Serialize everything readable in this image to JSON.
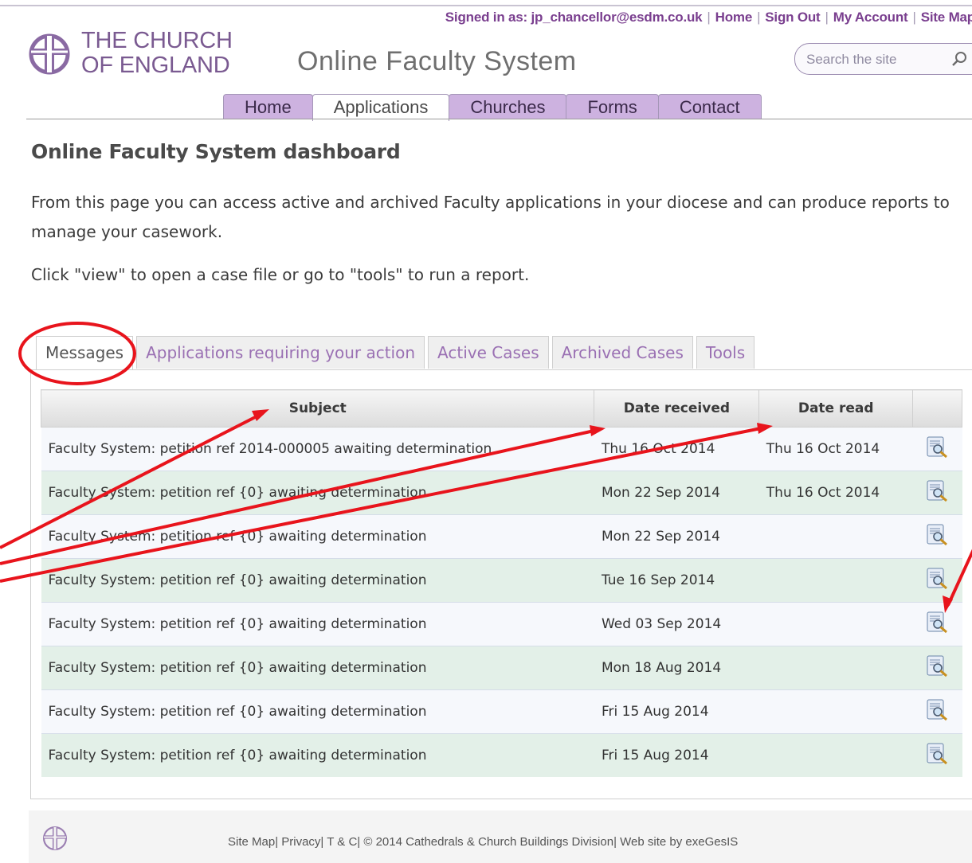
{
  "header": {
    "signed_in": "Signed in as: jp_chancellor@esdm.co.uk",
    "links": [
      "Home",
      "Sign Out",
      "My Account",
      "Site Map"
    ],
    "logo_line1": "THE CHURCH",
    "logo_line2": "OF ENGLAND",
    "system_title": "Online Faculty System",
    "search_placeholder": "Search the site"
  },
  "nav": {
    "tabs": [
      "Home",
      "Applications",
      "Churches",
      "Forms",
      "Contact"
    ],
    "active": "Applications"
  },
  "main": {
    "title": "Online Faculty System dashboard",
    "intro": "From this page you can access active and archived Faculty applications in your diocese and can produce reports to manage your casework.",
    "instruction": "Click \"view\" to open a case file or go to \"tools\" to run a report."
  },
  "subtabs": {
    "items": [
      "Messages",
      "Applications requiring your action",
      "Active Cases",
      "Archived Cases",
      "Tools"
    ],
    "active": "Messages"
  },
  "table": {
    "columns": [
      "Subject",
      "Date received",
      "Date read",
      ""
    ],
    "rows": [
      {
        "subject": "Faculty System: petition ref 2014-000005 awaiting determination",
        "received": "Thu 16 Oct 2014",
        "read": "Thu 16 Oct 2014"
      },
      {
        "subject": "Faculty System: petition ref {0} awaiting determination",
        "received": "Mon 22 Sep 2014",
        "read": "Thu 16 Oct 2014"
      },
      {
        "subject": "Faculty System: petition ref {0} awaiting determination",
        "received": "Mon 22 Sep 2014",
        "read": ""
      },
      {
        "subject": "Faculty System: petition ref {0} awaiting determination",
        "received": "Tue 16 Sep 2014",
        "read": ""
      },
      {
        "subject": "Faculty System: petition ref {0} awaiting determination",
        "received": "Wed 03 Sep 2014",
        "read": ""
      },
      {
        "subject": "Faculty System: petition ref {0} awaiting determination",
        "received": "Mon 18 Aug 2014",
        "read": ""
      },
      {
        "subject": "Faculty System: petition ref {0} awaiting determination",
        "received": "Fri 15 Aug 2014",
        "read": ""
      },
      {
        "subject": "Faculty System: petition ref {0} awaiting determination",
        "received": "Fri 15 Aug 2014",
        "read": ""
      }
    ]
  },
  "footer": {
    "text": "Site Map| Privacy| T & C| © 2014 Cathedrals & Church Buildings Division| Web site by exeGesIS"
  },
  "colors": {
    "brand_purple": "#7a3f8f",
    "nav_tab": "#cdb2e0",
    "row_odd": "#f6f8fc",
    "row_even": "#e3f0e8",
    "annotation_red": "#e8141c"
  },
  "icons": {
    "logo": "church-cross-icon",
    "search": "magnifier-icon",
    "row_action": "view-document-magnifier-icon"
  }
}
